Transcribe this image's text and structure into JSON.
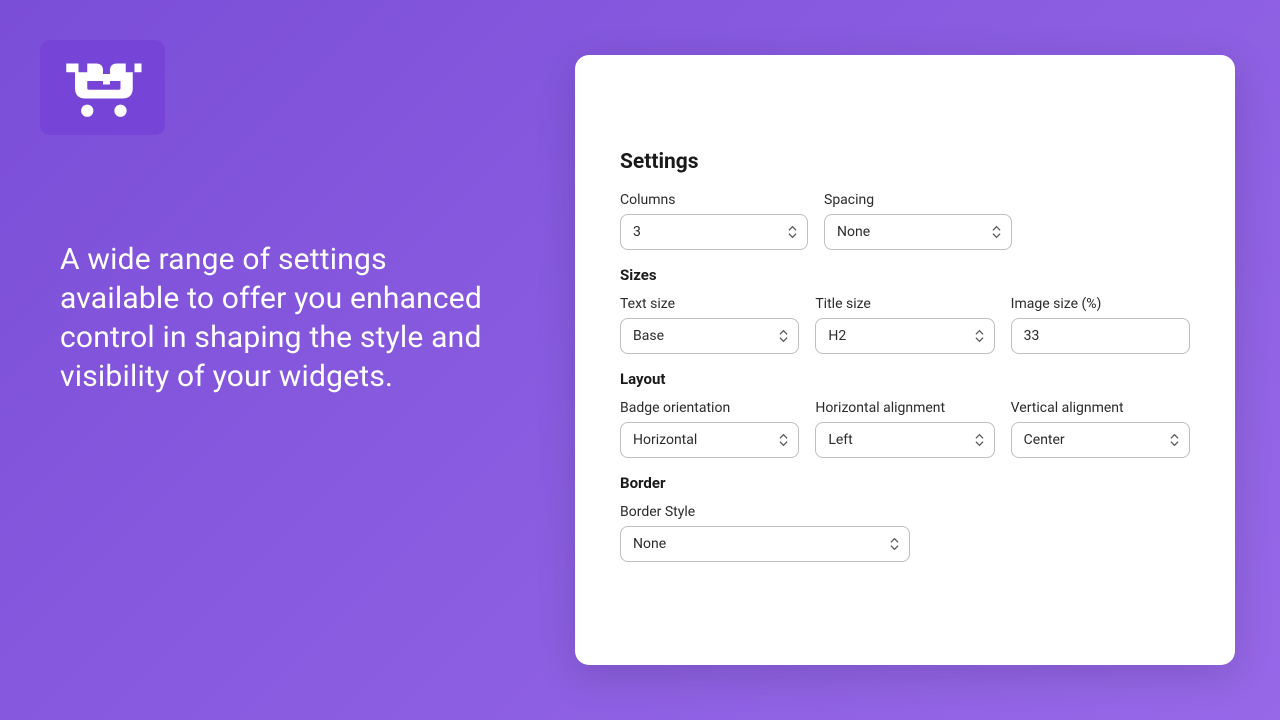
{
  "tagline": "A wide range of settings available to offer you enhanced control in shaping the style and visibility of your widgets.",
  "panel": {
    "title": "Settings",
    "columns": {
      "label": "Columns",
      "value": "3"
    },
    "spacing": {
      "label": "Spacing",
      "value": "None"
    },
    "sizes_heading": "Sizes",
    "text_size": {
      "label": "Text size",
      "value": "Base"
    },
    "title_size": {
      "label": "Title size",
      "value": "H2"
    },
    "image_size": {
      "label": "Image size (%)",
      "value": "33"
    },
    "layout_heading": "Layout",
    "badge_orientation": {
      "label": "Badge orientation",
      "value": "Horizontal"
    },
    "h_align": {
      "label": "Horizontal alignment",
      "value": "Left"
    },
    "v_align": {
      "label": "Vertical alignment",
      "value": "Center"
    },
    "border_heading": "Border",
    "border_style": {
      "label": "Border Style",
      "value": "None"
    }
  }
}
